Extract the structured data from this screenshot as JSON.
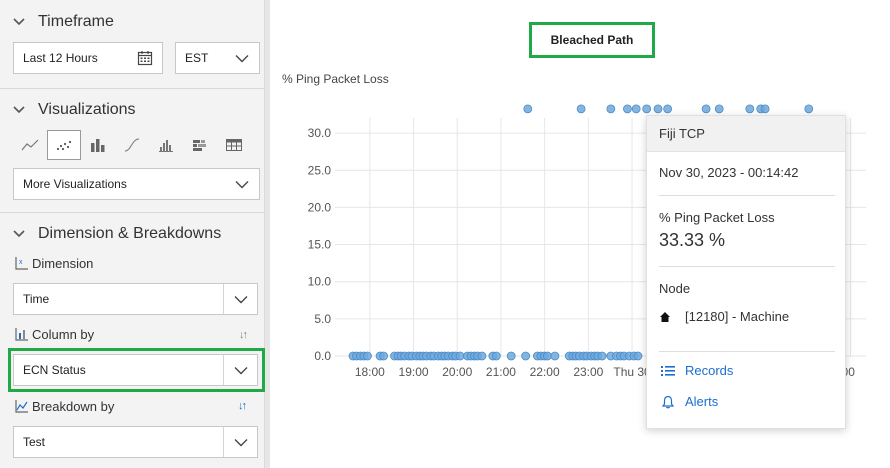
{
  "sidebar": {
    "timeframe": {
      "title": "Timeframe",
      "range_value": "Last 12 Hours",
      "timezone_value": "EST"
    },
    "visualizations": {
      "title": "Visualizations",
      "icons": [
        "line-chart-icon",
        "scatter-chart-icon",
        "bar-chart-icon",
        "curve-chart-icon",
        "histogram-icon",
        "stacked-bar-icon",
        "table-icon"
      ],
      "active_index": 1,
      "more_label": "More Visualizations"
    },
    "dimension_breakdowns": {
      "title": "Dimension & Breakdowns",
      "dimension_label": "Dimension",
      "dimension_value": "Time",
      "column_by_label": "Column by",
      "column_by_value": "ECN Status",
      "breakdown_by_label": "Breakdown by",
      "breakdown_by_value": "Test"
    }
  },
  "chart": {
    "title": "Bleached Path",
    "y_axis_label": "% Ping Packet Loss"
  },
  "chart_data": {
    "type": "scatter",
    "title": "Bleached Path",
    "ylabel": "% Ping Packet Loss",
    "ylim": [
      0,
      33.33
    ],
    "y_ticks": [
      "0.0",
      "5.0",
      "10.0",
      "15.0",
      "20.0",
      "25.0",
      "30.0"
    ],
    "x_ticks": [
      "18:00",
      "19:00",
      "20:00",
      "21:00",
      "22:00",
      "23:00",
      "Thu 30",
      "",
      "",
      "",
      "",
      ":00"
    ],
    "grid": true,
    "color": "#6fa8dc",
    "points_hours_from_17_30": {
      "high_value_33_33": [
        4.0,
        5.22,
        5.9,
        6.28,
        6.48,
        6.72,
        6.98,
        7.2,
        8.08,
        8.38,
        9.08,
        9.33,
        9.43,
        10.43
      ],
      "zero_value": [
        0.0,
        0.08,
        0.17,
        0.25,
        0.33,
        0.62,
        0.7,
        0.95,
        1.03,
        1.1,
        1.18,
        1.28,
        1.35,
        1.45,
        1.53,
        1.6,
        1.68,
        1.78,
        1.85,
        1.95,
        2.03,
        2.1,
        2.18,
        2.28,
        2.35,
        2.45,
        2.62,
        2.7,
        2.78,
        2.85,
        2.95,
        3.2,
        3.28,
        3.62,
        3.95,
        4.22,
        4.3,
        4.38,
        4.45,
        4.62,
        4.95,
        5.03,
        5.1,
        5.18,
        5.28,
        5.35,
        5.45,
        5.53,
        5.6,
        5.7,
        5.9,
        6.03,
        6.12,
        6.2,
        6.32,
        6.43,
        6.52,
        6.95,
        7.03,
        7.12,
        10.2,
        10.28,
        10.36,
        10.44,
        10.52,
        10.6,
        10.7
      ]
    }
  },
  "tooltip": {
    "series": "Fiji TCP",
    "timestamp": "Nov 30, 2023 - 00:14:42",
    "metric_label": "% Ping Packet Loss",
    "metric_value": "33.33 %",
    "node_label": "Node",
    "node_value": "[12180] - Machine",
    "records_label": "Records",
    "alerts_label": "Alerts"
  },
  "colors": {
    "highlight": "#22a947",
    "link": "#1a6fd1",
    "point": "#6fa8dc"
  }
}
